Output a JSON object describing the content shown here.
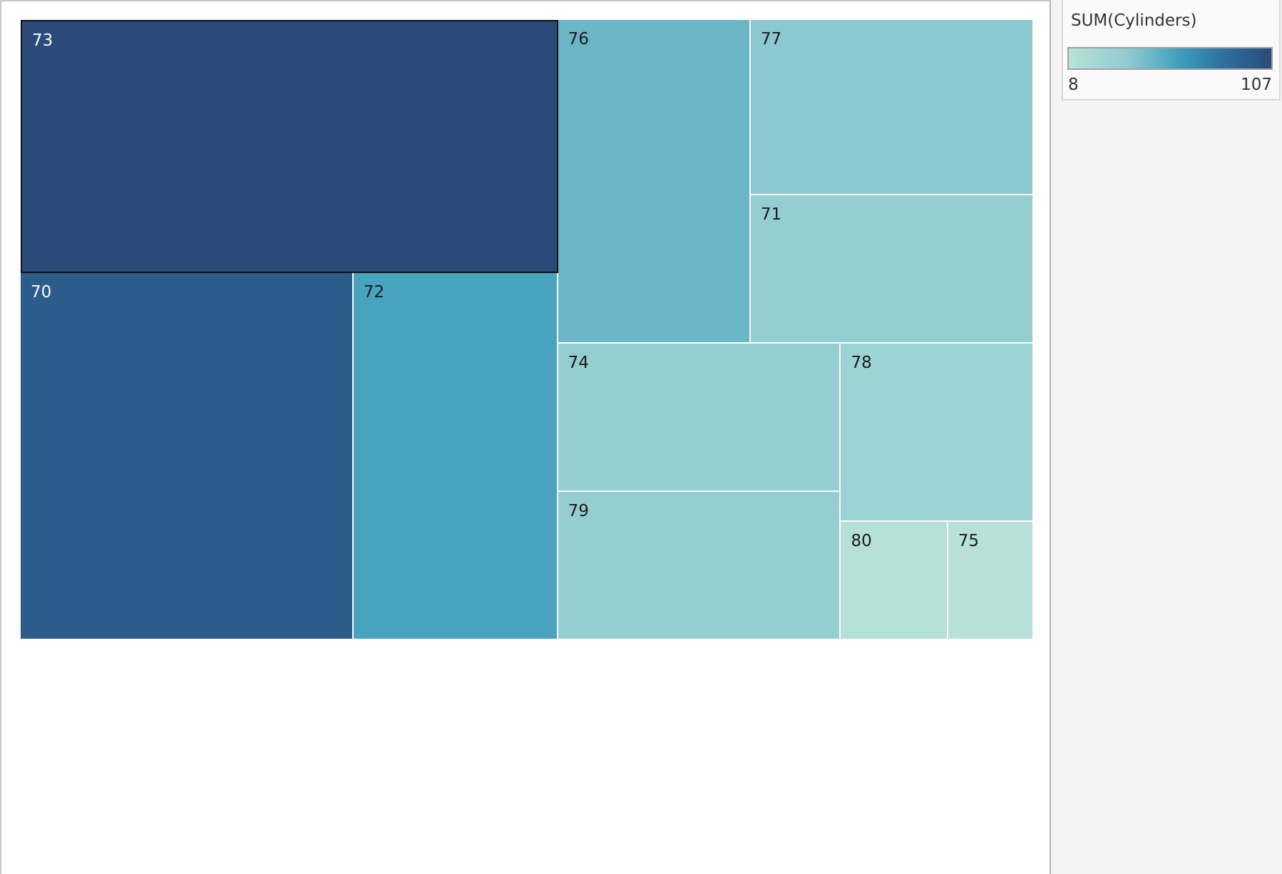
{
  "legend": {
    "title": "SUM(Cylinders)",
    "min_label": "8",
    "max_label": "107",
    "color_low": "#b8e2d9",
    "color_mid": "#3d9ebb",
    "color_high": "#2a4b7a"
  },
  "chart_data": {
    "type": "treemap",
    "measure": "SUM(Cylinders)",
    "color_range": [
      8,
      107
    ],
    "selected": "73",
    "items": [
      {
        "label": "73",
        "value": 107
      },
      {
        "label": "70",
        "value": 96
      },
      {
        "label": "72",
        "value": 59
      },
      {
        "label": "76",
        "value": 49
      },
      {
        "label": "77",
        "value": 39
      },
      {
        "label": "71",
        "value": 33
      },
      {
        "label": "74",
        "value": 33
      },
      {
        "label": "79",
        "value": 33
      },
      {
        "label": "78",
        "value": 27
      },
      {
        "label": "80",
        "value": 10
      },
      {
        "label": "75",
        "value": 8
      }
    ]
  }
}
